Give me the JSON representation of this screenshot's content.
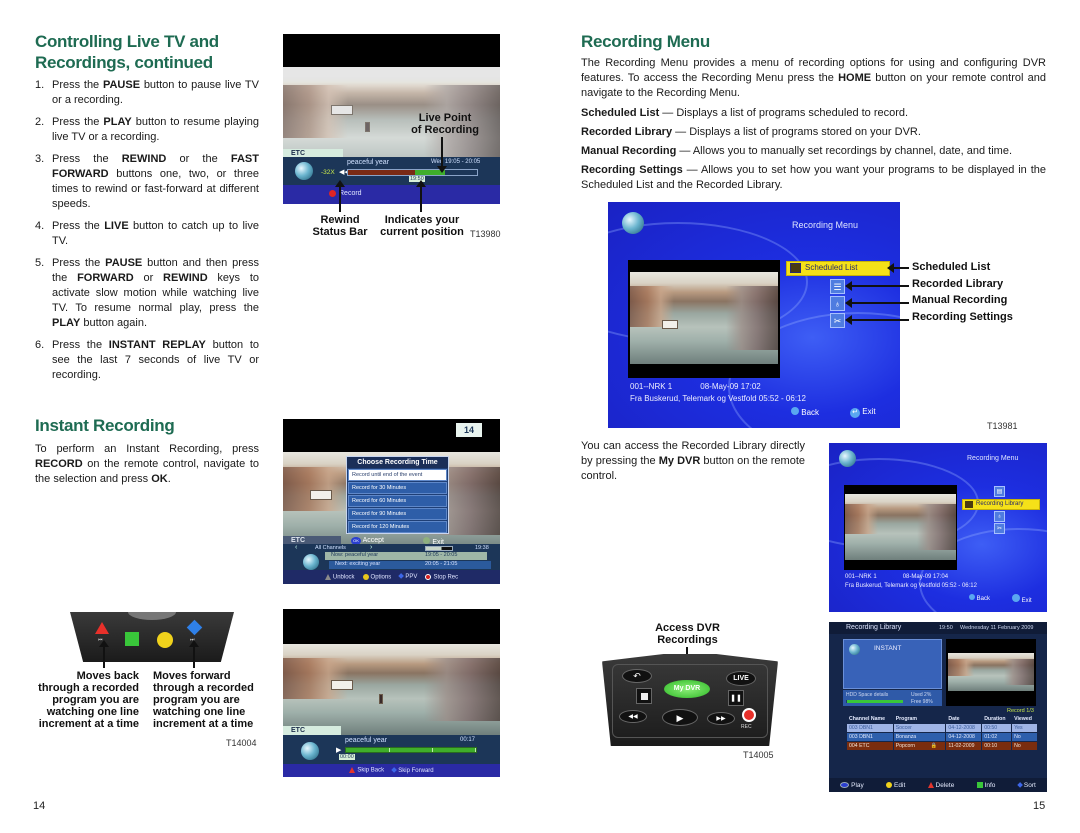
{
  "left_page": {
    "heading": "Controlling Live TV and Recordings, continued",
    "heading_line1": "Controlling Live TV and",
    "heading_line2": "Recordings, continued",
    "steps": [
      {
        "num": "1.",
        "pre": "Press the ",
        "bold": "PAUSE",
        "post": " button to pause live TV or a recording."
      },
      {
        "num": "2.",
        "pre": "Press the ",
        "bold": "PLAY",
        "post": " button to resume playing live TV or a recording."
      },
      {
        "num": "3.",
        "pre": "Press the ",
        "bold": "REWIND",
        "mid": " or the ",
        "bold2": "FAST FORWARD",
        "post": " buttons one, two, or three times to rewind or fast-forward at different speeds."
      },
      {
        "num": "4.",
        "pre": "Press the ",
        "bold": "LIVE",
        "post": " button to catch up to live TV."
      },
      {
        "num": "5.",
        "pre": "Press the ",
        "bold": "PAUSE",
        "mid": " button and then press the ",
        "bold2": "FORWARD",
        "mid2": " or ",
        "bold3": "REWIND",
        "mid3": " keys to activate slow motion while watching live TV.  To resume normal play, press the ",
        "bold4": "PLAY",
        "post": " button again."
      },
      {
        "num": "6.",
        "pre": "Press the ",
        "bold": "INSTANT REPLAY",
        "post": " button to see the last 7 seconds of live TV or recording."
      }
    ],
    "instant_heading": "Instant Recording",
    "instant_text": {
      "pre": "To perform an Instant Recording, press ",
      "bold": "RECORD",
      "mid": " on the remote control, navigate to the selection and press ",
      "bold2": "OK",
      "post": "."
    },
    "page_number": "14"
  },
  "figure_rewind": {
    "channel_tag": "ETC",
    "program": "peaceful year",
    "time_range": "Wed 19:05 - 20:05",
    "speed": "-32X",
    "position_time": "19:50",
    "record_label": "Record",
    "recorded_fraction": 0.52,
    "buffer_fraction": 0.75,
    "callout_live_point": [
      "Live Point",
      "of Recording"
    ],
    "callout_rewind": [
      "Rewind",
      "Status Bar"
    ],
    "callout_position": [
      "Indicates your",
      "current position"
    ],
    "code": "T13980"
  },
  "figure_instant": {
    "channel_number": "14",
    "dialog_title": "Choose Recording Time",
    "options": [
      "Record until end of the event",
      "Record for 30 Minutes",
      "Record for 60 Minutes",
      "Record for 90 Minutes",
      "Record for 120 Minutes"
    ],
    "selected_index": 0,
    "accept_label": "Accept",
    "exit_label": "Exit",
    "ok_badge": "OK",
    "channel_tag": "ETC",
    "list_label": "All Channels",
    "clock": "19:38",
    "now": {
      "label": "Now: peaceful year",
      "time": "19:05 - 20:05"
    },
    "next": {
      "label": "Next: exciting year",
      "time": "20:05 - 21:05"
    },
    "footer": [
      {
        "icon": "triangle",
        "color": "#8b8b8b",
        "label": "Unblock"
      },
      {
        "icon": "circle",
        "color": "#e8c61b",
        "label": "Options"
      },
      {
        "icon": "diamond",
        "color": "#3d66e8",
        "label": "PPV"
      },
      {
        "icon": "record",
        "color": "#d32020",
        "label": "Stop Rec"
      }
    ]
  },
  "figure_remote_skip": {
    "caption_back": [
      "Moves back",
      "through a recorded",
      "program you are",
      "watching one line",
      "increment at a time"
    ],
    "caption_forward": [
      "Moves forward",
      "through a recorded",
      "program you are",
      "watching one line",
      "increment at a time"
    ],
    "code": "T14004",
    "button_colors": {
      "red": "#e8302a",
      "green": "#39c63a",
      "yellow": "#f0d21c",
      "blue": "#2f80e8"
    }
  },
  "figure_playback": {
    "channel_tag": "ETC",
    "program": "peaceful year",
    "duration": "00:17",
    "position": "00:00",
    "progress_fraction": 0.0,
    "footer": [
      {
        "icon": "triangle",
        "color": "#e2342c",
        "label": "Skip Back"
      },
      {
        "icon": "diamond",
        "color": "#3d66e8",
        "label": "Skip Forward"
      }
    ]
  },
  "right_page": {
    "heading": "Recording Menu",
    "intro": {
      "pre": "The Recording Menu provides a menu of recording options for using and configuring DVR features. To access the Recording Menu press the ",
      "bold": "HOME",
      "post": " button on your remote control and navigate to the Recording Menu."
    },
    "definitions": [
      {
        "term": "Scheduled List",
        "desc": " — Displays a list of programs scheduled to record."
      },
      {
        "term": "Recorded Library",
        "desc": " — Displays a list of programs stored on your DVR."
      },
      {
        "term": "Manual Recording",
        "desc": " — Allows you to manually set recordings by channel, date, and time."
      },
      {
        "term": "Recording Settings",
        "desc": " — Allows you to set how you want your programs to be displayed in the Scheduled List and the Recorded Library."
      }
    ],
    "access_text": {
      "pre": "You can access the Recorded Library directly by pressing the ",
      "bold": "My DVR",
      "post": " button on the remote control."
    },
    "page_number": "15"
  },
  "figure_recording_menu": {
    "title": "Recording Menu",
    "selected_item": "Scheduled List",
    "channel": "001--NRK 1",
    "datetime": "08-May-09 17:02",
    "program_info": "Fra Buskerud, Telemark og Vestfold 05:52 - 06:12",
    "back_label": "Back",
    "exit_label": "Exit",
    "callouts": [
      "Scheduled List",
      "Recorded Library",
      "Manual Recording",
      "Recording Settings"
    ],
    "code": "T13981"
  },
  "figure_recording_menu_2": {
    "title": "Recording Menu",
    "selected_item": "Recording Library",
    "channel": "001--NRK 1",
    "datetime": "08-May-09 17:04",
    "program_info": "Fra Buskerud, Telemark og Vestfold 05:52 - 06:12",
    "back_label": "Back",
    "exit_label": "Exit"
  },
  "figure_remote_dvr": {
    "callout": [
      "Access DVR",
      "Recordings"
    ],
    "buttons": {
      "back": "↶",
      "live": "LIVE",
      "my_dvr": "My DVR",
      "rec": "REC"
    },
    "code": "T14005"
  },
  "figure_recording_library": {
    "title": "Recording Library",
    "time": "19:50",
    "date": "Wednesday 11 February 2009",
    "folder": "INSTANT",
    "hdd_label": "HDD Space details",
    "used": "Used 2%",
    "free": "Free 98%",
    "used_fraction": 0.02,
    "record_counter": "Record 1/3",
    "columns": [
      "Channel Name",
      "Program",
      "Date",
      "Duration",
      "Viewed"
    ],
    "rows": [
      {
        "channel": "003 DBN1",
        "program": "Soccer",
        "date": "04-12-2008",
        "duration": "00:50",
        "viewed": "Yes",
        "locked": false
      },
      {
        "channel": "003 DBN1",
        "program": "Bonanza",
        "date": "04-12-2008",
        "duration": "01:02",
        "viewed": "No",
        "locked": false
      },
      {
        "channel": "004 ETC",
        "program": "Popcorn",
        "date": "11-02-2009",
        "duration": "00:10",
        "viewed": "No",
        "locked": true
      }
    ],
    "footer": [
      {
        "icon": "ok",
        "color": "#2b3fd0",
        "label": "Play"
      },
      {
        "icon": "circle",
        "color": "#f0d21c",
        "label": "Edit"
      },
      {
        "icon": "triangle",
        "color": "#e2342c",
        "label": "Delete"
      },
      {
        "icon": "square",
        "color": "#39c63a",
        "label": "Info"
      },
      {
        "icon": "diamond",
        "color": "#3d66e8",
        "label": "Sort"
      }
    ]
  }
}
